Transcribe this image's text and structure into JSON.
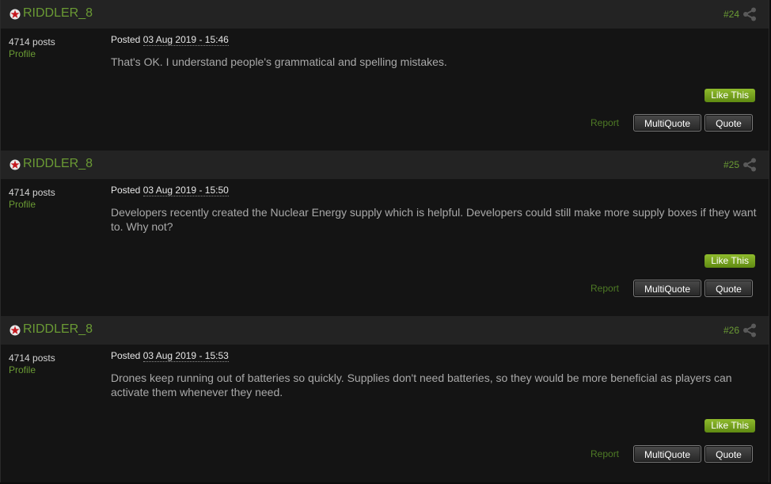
{
  "theme": {
    "accent": "#6a9a34",
    "like_button": "#7aa820",
    "background": "#141414",
    "header": "#232323"
  },
  "posts": [
    {
      "author": "RIDDLER_8",
      "number": "#24",
      "post_count": "4714 posts",
      "profile_label": "Profile",
      "posted_label": "Posted",
      "posted_date": "03 Aug 2019 - 15:46",
      "text": "That's OK. I understand people's grammatical and spelling mistakes.",
      "like_label": "Like This",
      "report_label": "Report",
      "multiquote_label": "MultiQuote",
      "quote_label": "Quote"
    },
    {
      "author": "RIDDLER_8",
      "number": "#25",
      "post_count": "4714 posts",
      "profile_label": "Profile",
      "posted_label": "Posted",
      "posted_date": "03 Aug 2019 - 15:50",
      "text": "Developers recently created the Nuclear Energy supply which is helpful. Developers could still make more supply boxes if they want to. Why not?",
      "like_label": "Like This",
      "report_label": "Report",
      "multiquote_label": "MultiQuote",
      "quote_label": "Quote"
    },
    {
      "author": "RIDDLER_8",
      "number": "#26",
      "post_count": "4714 posts",
      "profile_label": "Profile",
      "posted_label": "Posted",
      "posted_date": "03 Aug 2019 - 15:53",
      "text": "Drones keep running out of batteries so quickly. Supplies don't need batteries, so they would be more beneficial as players can activate them whenever they need.",
      "like_label": "Like This",
      "report_label": "Report",
      "multiquote_label": "MultiQuote",
      "quote_label": "Quote"
    }
  ]
}
